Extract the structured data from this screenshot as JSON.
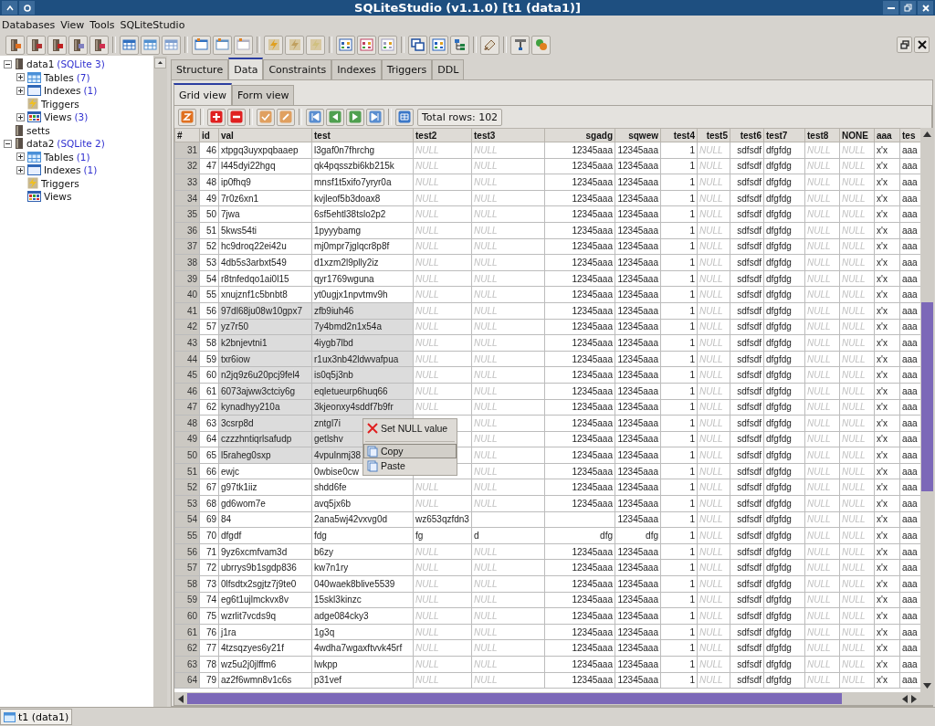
{
  "window": {
    "title": "SQLiteStudio (v1.1.0) [t1 (data1)]"
  },
  "menu": [
    "Databases",
    "View",
    "Tools",
    "SQLiteStudio"
  ],
  "tree": [
    {
      "label": "data1",
      "note": "(SQLite 3)",
      "kind": "database",
      "expanded": true,
      "children": [
        {
          "label": "Tables",
          "note": "(7)",
          "kind": "tables",
          "expanded": false
        },
        {
          "label": "Indexes",
          "note": "(1)",
          "kind": "indexes",
          "expanded": false
        },
        {
          "label": "Triggers",
          "kind": "triggers"
        },
        {
          "label": "Views",
          "note": "(3)",
          "kind": "views",
          "expanded": false
        }
      ]
    },
    {
      "label": "setts",
      "kind": "database"
    },
    {
      "label": "data2",
      "note": "(SQLite 2)",
      "kind": "database",
      "expanded": true,
      "children": [
        {
          "label": "Tables",
          "note": "(1)",
          "kind": "tables",
          "expanded": false
        },
        {
          "label": "Indexes",
          "note": "(1)",
          "kind": "indexes",
          "expanded": false
        },
        {
          "label": "Triggers",
          "kind": "triggers"
        },
        {
          "label": "Views",
          "kind": "views"
        }
      ]
    }
  ],
  "tabs": [
    {
      "label": "Structure",
      "selected": false
    },
    {
      "label": "Data",
      "selected": true
    },
    {
      "label": "Constraints",
      "selected": false
    },
    {
      "label": "Indexes",
      "selected": false
    },
    {
      "label": "Triggers",
      "selected": false
    },
    {
      "label": "DDL",
      "selected": false
    }
  ],
  "subtabs": [
    {
      "label": "Grid view",
      "selected": true
    },
    {
      "label": "Form view",
      "selected": false
    }
  ],
  "total_rows": "Total rows: 102",
  "table": {
    "columns": [
      "#",
      "id",
      "val",
      "test",
      "test2",
      "test3",
      "sgadg",
      "sqwew",
      "test4",
      "test5",
      "test6",
      "test7",
      "test8",
      "NONE",
      "aaa",
      "tes"
    ],
    "rows": [
      {
        "selected": false,
        "cells": [
          "31",
          "46",
          "xtpgq3uyxpqbaaep",
          "l3gaf0n7fhrchg",
          {
            "text": "NULL",
            "null": true
          },
          {
            "text": "NULL",
            "null": true
          },
          "12345aaa",
          "12345aaa",
          "1",
          {
            "text": "NULL",
            "null": true
          },
          "sdfsdf",
          "dfgfdg",
          {
            "text": "NULL",
            "null": true
          },
          {
            "text": "NULL",
            "null": true
          },
          "x'x",
          "aaa"
        ]
      },
      {
        "selected": false,
        "cells": [
          "32",
          "47",
          "l445dyi22hgq",
          "qk4pqsszbi6kb215k",
          {
            "text": "NULL",
            "null": true
          },
          {
            "text": "NULL",
            "null": true
          },
          "12345aaa",
          "12345aaa",
          "1",
          {
            "text": "NULL",
            "null": true
          },
          "sdfsdf",
          "dfgfdg",
          {
            "text": "NULL",
            "null": true
          },
          {
            "text": "NULL",
            "null": true
          },
          "x'x",
          "aaa"
        ]
      },
      {
        "selected": false,
        "cells": [
          "33",
          "48",
          "ip0fhq9",
          "mnsf1t5xifo7yryr0a",
          {
            "text": "NULL",
            "null": true
          },
          {
            "text": "NULL",
            "null": true
          },
          "12345aaa",
          "12345aaa",
          "1",
          {
            "text": "NULL",
            "null": true
          },
          "sdfsdf",
          "dfgfdg",
          {
            "text": "NULL",
            "null": true
          },
          {
            "text": "NULL",
            "null": true
          },
          "x'x",
          "aaa"
        ]
      },
      {
        "selected": false,
        "cells": [
          "34",
          "49",
          "7r0z6xn1",
          "kvjleof5b3doax8",
          {
            "text": "NULL",
            "null": true
          },
          {
            "text": "NULL",
            "null": true
          },
          "12345aaa",
          "12345aaa",
          "1",
          {
            "text": "NULL",
            "null": true
          },
          "sdfsdf",
          "dfgfdg",
          {
            "text": "NULL",
            "null": true
          },
          {
            "text": "NULL",
            "null": true
          },
          "x'x",
          "aaa"
        ]
      },
      {
        "selected": false,
        "cells": [
          "35",
          "50",
          "7jwa",
          "6sf5ehtl38tslo2p2",
          {
            "text": "NULL",
            "null": true
          },
          {
            "text": "NULL",
            "null": true
          },
          "12345aaa",
          "12345aaa",
          "1",
          {
            "text": "NULL",
            "null": true
          },
          "sdfsdf",
          "dfgfdg",
          {
            "text": "NULL",
            "null": true
          },
          {
            "text": "NULL",
            "null": true
          },
          "x'x",
          "aaa"
        ]
      },
      {
        "selected": false,
        "cells": [
          "36",
          "51",
          "5kws54ti",
          "1pyyybamg",
          {
            "text": "NULL",
            "null": true
          },
          {
            "text": "NULL",
            "null": true
          },
          "12345aaa",
          "12345aaa",
          "1",
          {
            "text": "NULL",
            "null": true
          },
          "sdfsdf",
          "dfgfdg",
          {
            "text": "NULL",
            "null": true
          },
          {
            "text": "NULL",
            "null": true
          },
          "x'x",
          "aaa"
        ]
      },
      {
        "selected": false,
        "cells": [
          "37",
          "52",
          "hc9droq22ei42u",
          "mj0mpr7jglqcr8p8f",
          {
            "text": "NULL",
            "null": true
          },
          {
            "text": "NULL",
            "null": true
          },
          "12345aaa",
          "12345aaa",
          "1",
          {
            "text": "NULL",
            "null": true
          },
          "sdfsdf",
          "dfgfdg",
          {
            "text": "NULL",
            "null": true
          },
          {
            "text": "NULL",
            "null": true
          },
          "x'x",
          "aaa"
        ]
      },
      {
        "selected": false,
        "cells": [
          "38",
          "53",
          "4db5s3arbxt549",
          "d1xzm2l9plly2iz",
          {
            "text": "NULL",
            "null": true
          },
          {
            "text": "NULL",
            "null": true
          },
          "12345aaa",
          "12345aaa",
          "1",
          {
            "text": "NULL",
            "null": true
          },
          "sdfsdf",
          "dfgfdg",
          {
            "text": "NULL",
            "null": true
          },
          {
            "text": "NULL",
            "null": true
          },
          "x'x",
          "aaa"
        ]
      },
      {
        "selected": false,
        "cells": [
          "39",
          "54",
          "r8tnfedqo1ai0l15",
          "qyr1769wguna",
          {
            "text": "NULL",
            "null": true
          },
          {
            "text": "NULL",
            "null": true
          },
          "12345aaa",
          "12345aaa",
          "1",
          {
            "text": "NULL",
            "null": true
          },
          "sdfsdf",
          "dfgfdg",
          {
            "text": "NULL",
            "null": true
          },
          {
            "text": "NULL",
            "null": true
          },
          "x'x",
          "aaa"
        ]
      },
      {
        "selected": false,
        "cells": [
          "40",
          "55",
          "xnujznf1c5bnbt8",
          "yt0ugjx1npvtmv9h",
          {
            "text": "NULL",
            "null": true
          },
          {
            "text": "NULL",
            "null": true
          },
          "12345aaa",
          "12345aaa",
          "1",
          {
            "text": "NULL",
            "null": true
          },
          "sdfsdf",
          "dfgfdg",
          {
            "text": "NULL",
            "null": true
          },
          {
            "text": "NULL",
            "null": true
          },
          "x'x",
          "aaa"
        ]
      },
      {
        "selected": true,
        "cells": [
          "41",
          "56",
          "97dl68ju08w10gpx7",
          "zfb9iuh46",
          {
            "text": "NULL",
            "null": true
          },
          {
            "text": "NULL",
            "null": true
          },
          "12345aaa",
          "12345aaa",
          "1",
          {
            "text": "NULL",
            "null": true
          },
          "sdfsdf",
          "dfgfdg",
          {
            "text": "NULL",
            "null": true
          },
          {
            "text": "NULL",
            "null": true
          },
          "x'x",
          "aaa"
        ]
      },
      {
        "selected": true,
        "cells": [
          "42",
          "57",
          "yz7r50",
          "7y4bmd2n1x54a",
          {
            "text": "NULL",
            "null": true
          },
          {
            "text": "NULL",
            "null": true
          },
          "12345aaa",
          "12345aaa",
          "1",
          {
            "text": "NULL",
            "null": true
          },
          "sdfsdf",
          "dfgfdg",
          {
            "text": "NULL",
            "null": true
          },
          {
            "text": "NULL",
            "null": true
          },
          "x'x",
          "aaa"
        ]
      },
      {
        "selected": true,
        "cells": [
          "43",
          "58",
          "k2bnjevtni1",
          "4iygb7lbd",
          {
            "text": "NULL",
            "null": true
          },
          {
            "text": "NULL",
            "null": true
          },
          "12345aaa",
          "12345aaa",
          "1",
          {
            "text": "NULL",
            "null": true
          },
          "sdfsdf",
          "dfgfdg",
          {
            "text": "NULL",
            "null": true
          },
          {
            "text": "NULL",
            "null": true
          },
          "x'x",
          "aaa"
        ]
      },
      {
        "selected": true,
        "cells": [
          "44",
          "59",
          "txr6iow",
          "r1ux3nb42ldwvafpua",
          {
            "text": "NULL",
            "null": true
          },
          {
            "text": "NULL",
            "null": true
          },
          "12345aaa",
          "12345aaa",
          "1",
          {
            "text": "NULL",
            "null": true
          },
          "sdfsdf",
          "dfgfdg",
          {
            "text": "NULL",
            "null": true
          },
          {
            "text": "NULL",
            "null": true
          },
          "x'x",
          "aaa"
        ]
      },
      {
        "selected": true,
        "cells": [
          "45",
          "60",
          "n2jq9z6u20pcj9fel4",
          "is0q5j3nb",
          {
            "text": "NULL",
            "null": true
          },
          {
            "text": "NULL",
            "null": true
          },
          "12345aaa",
          "12345aaa",
          "1",
          {
            "text": "NULL",
            "null": true
          },
          "sdfsdf",
          "dfgfdg",
          {
            "text": "NULL",
            "null": true
          },
          {
            "text": "NULL",
            "null": true
          },
          "x'x",
          "aaa"
        ]
      },
      {
        "selected": true,
        "cells": [
          "46",
          "61",
          "6073ajww3ctciy6g",
          "eqletueurp6huq66",
          {
            "text": "NULL",
            "null": true
          },
          {
            "text": "NULL",
            "null": true
          },
          "12345aaa",
          "12345aaa",
          "1",
          {
            "text": "NULL",
            "null": true
          },
          "sdfsdf",
          "dfgfdg",
          {
            "text": "NULL",
            "null": true
          },
          {
            "text": "NULL",
            "null": true
          },
          "x'x",
          "aaa"
        ]
      },
      {
        "selected": true,
        "cells": [
          "47",
          "62",
          "kynadhyy210a",
          "3kjeonxy4sddf7b9fr",
          {
            "text": "NULL",
            "null": true
          },
          {
            "text": "NULL",
            "null": true
          },
          "12345aaa",
          "12345aaa",
          "1",
          {
            "text": "NULL",
            "null": true
          },
          "sdfsdf",
          "dfgfdg",
          {
            "text": "NULL",
            "null": true
          },
          {
            "text": "NULL",
            "null": true
          },
          "x'x",
          "aaa"
        ]
      },
      {
        "selected": true,
        "cells": [
          "48",
          "63",
          "3csrp8d",
          "zntgl7i",
          null,
          {
            "text": "NULL",
            "null": true
          },
          "12345aaa",
          "12345aaa",
          "1",
          {
            "text": "NULL",
            "null": true
          },
          "sdfsdf",
          "dfgfdg",
          {
            "text": "NULL",
            "null": true
          },
          {
            "text": "NULL",
            "null": true
          },
          "x'x",
          "aaa"
        ]
      },
      {
        "selected": true,
        "cells": [
          "49",
          "64",
          "czzzhntiqrlsafudp",
          "getlshv",
          null,
          {
            "text": "NULL",
            "null": true
          },
          "12345aaa",
          "12345aaa",
          "1",
          {
            "text": "NULL",
            "null": true
          },
          "sdfsdf",
          "dfgfdg",
          {
            "text": "NULL",
            "null": true
          },
          {
            "text": "NULL",
            "null": true
          },
          "x'x",
          "aaa"
        ]
      },
      {
        "selected": true,
        "cells": [
          "50",
          "65",
          "l5raheg0sxp",
          "4vpulnmj38",
          null,
          {
            "text": "NULL",
            "null": true
          },
          "12345aaa",
          "12345aaa",
          "1",
          {
            "text": "NULL",
            "null": true
          },
          "sdfsdf",
          "dfgfdg",
          {
            "text": "NULL",
            "null": true
          },
          {
            "text": "NULL",
            "null": true
          },
          "x'x",
          "aaa"
        ]
      },
      {
        "selected": false,
        "cells": [
          "51",
          "66",
          "ewjc",
          "0wbise0cw",
          null,
          {
            "text": "NULL",
            "null": true
          },
          "12345aaa",
          "12345aaa",
          "1",
          {
            "text": "NULL",
            "null": true
          },
          "sdfsdf",
          "dfgfdg",
          {
            "text": "NULL",
            "null": true
          },
          {
            "text": "NULL",
            "null": true
          },
          "x'x",
          "aaa"
        ]
      },
      {
        "selected": false,
        "cells": [
          "52",
          "67",
          "g97tk1iiz",
          "shdd6fe",
          {
            "text": "NULL",
            "null": true
          },
          {
            "text": "NULL",
            "null": true
          },
          "12345aaa",
          "12345aaa",
          "1",
          {
            "text": "NULL",
            "null": true
          },
          "sdfsdf",
          "dfgfdg",
          {
            "text": "NULL",
            "null": true
          },
          {
            "text": "NULL",
            "null": true
          },
          "x'x",
          "aaa"
        ]
      },
      {
        "selected": false,
        "cells": [
          "53",
          "68",
          "gd6wom7e",
          "avq5jx6b",
          {
            "text": "NULL",
            "null": true
          },
          {
            "text": "NULL",
            "null": true
          },
          "12345aaa",
          "12345aaa",
          "1",
          {
            "text": "NULL",
            "null": true
          },
          "sdfsdf",
          "dfgfdg",
          {
            "text": "NULL",
            "null": true
          },
          {
            "text": "NULL",
            "null": true
          },
          "x'x",
          "aaa"
        ]
      },
      {
        "selected": false,
        "cells": [
          "54",
          "69",
          "84",
          "2ana5wj42vxvg0d",
          "wz653qzfdn3",
          null,
          null,
          "12345aaa",
          "1",
          {
            "text": "NULL",
            "null": true
          },
          "sdfsdf",
          "dfgfdg",
          {
            "text": "NULL",
            "null": true
          },
          {
            "text": "NULL",
            "null": true
          },
          "x'x",
          "aaa"
        ]
      },
      {
        "selected": false,
        "cells": [
          "55",
          "70",
          "dfgdf",
          "fdg",
          "fg",
          "d",
          "dfg",
          "dfg",
          "1",
          {
            "text": "NULL",
            "null": true
          },
          "sdfsdf",
          "dfgfdg",
          {
            "text": "NULL",
            "null": true
          },
          {
            "text": "NULL",
            "null": true
          },
          "x'x",
          "aaa"
        ]
      },
      {
        "selected": false,
        "cells": [
          "56",
          "71",
          "9yz6xcmfvam3d",
          "b6zy",
          {
            "text": "NULL",
            "null": true
          },
          {
            "text": "NULL",
            "null": true
          },
          "12345aaa",
          "12345aaa",
          "1",
          {
            "text": "NULL",
            "null": true
          },
          "sdfsdf",
          "dfgfdg",
          {
            "text": "NULL",
            "null": true
          },
          {
            "text": "NULL",
            "null": true
          },
          "x'x",
          "aaa"
        ]
      },
      {
        "selected": false,
        "cells": [
          "57",
          "72",
          "ubrrys9b1sgdp836",
          "kw7n1ry",
          {
            "text": "NULL",
            "null": true
          },
          {
            "text": "NULL",
            "null": true
          },
          "12345aaa",
          "12345aaa",
          "1",
          {
            "text": "NULL",
            "null": true
          },
          "sdfsdf",
          "dfgfdg",
          {
            "text": "NULL",
            "null": true
          },
          {
            "text": "NULL",
            "null": true
          },
          "x'x",
          "aaa"
        ]
      },
      {
        "selected": false,
        "cells": [
          "58",
          "73",
          "0lfsdtx2sgjtz7j9te0",
          "040waek8blive5539",
          {
            "text": "NULL",
            "null": true
          },
          {
            "text": "NULL",
            "null": true
          },
          "12345aaa",
          "12345aaa",
          "1",
          {
            "text": "NULL",
            "null": true
          },
          "sdfsdf",
          "dfgfdg",
          {
            "text": "NULL",
            "null": true
          },
          {
            "text": "NULL",
            "null": true
          },
          "x'x",
          "aaa"
        ]
      },
      {
        "selected": false,
        "cells": [
          "59",
          "74",
          "eg6t1ujlmckvx8v",
          "15skl3kinzc",
          {
            "text": "NULL",
            "null": true
          },
          {
            "text": "NULL",
            "null": true
          },
          "12345aaa",
          "12345aaa",
          "1",
          {
            "text": "NULL",
            "null": true
          },
          "sdfsdf",
          "dfgfdg",
          {
            "text": "NULL",
            "null": true
          },
          {
            "text": "NULL",
            "null": true
          },
          "x'x",
          "aaa"
        ]
      },
      {
        "selected": false,
        "cells": [
          "60",
          "75",
          "wzrlit7vcds9q",
          "adge084cky3",
          {
            "text": "NULL",
            "null": true
          },
          {
            "text": "NULL",
            "null": true
          },
          "12345aaa",
          "12345aaa",
          "1",
          {
            "text": "NULL",
            "null": true
          },
          "sdfsdf",
          "dfgfdg",
          {
            "text": "NULL",
            "null": true
          },
          {
            "text": "NULL",
            "null": true
          },
          "x'x",
          "aaa"
        ]
      },
      {
        "selected": false,
        "cells": [
          "61",
          "76",
          "j1ra",
          "1g3q",
          {
            "text": "NULL",
            "null": true
          },
          {
            "text": "NULL",
            "null": true
          },
          "12345aaa",
          "12345aaa",
          "1",
          {
            "text": "NULL",
            "null": true
          },
          "sdfsdf",
          "dfgfdg",
          {
            "text": "NULL",
            "null": true
          },
          {
            "text": "NULL",
            "null": true
          },
          "x'x",
          "aaa"
        ]
      },
      {
        "selected": false,
        "cells": [
          "62",
          "77",
          "4tzsqzyes6y21f",
          "4wdha7wgaxftvvk45rf",
          {
            "text": "NULL",
            "null": true
          },
          {
            "text": "NULL",
            "null": true
          },
          "12345aaa",
          "12345aaa",
          "1",
          {
            "text": "NULL",
            "null": true
          },
          "sdfsdf",
          "dfgfdg",
          {
            "text": "NULL",
            "null": true
          },
          {
            "text": "NULL",
            "null": true
          },
          "x'x",
          "aaa"
        ]
      },
      {
        "selected": false,
        "cells": [
          "63",
          "78",
          "wz5u2j0jlffm6",
          "lwkpp",
          {
            "text": "NULL",
            "null": true
          },
          {
            "text": "NULL",
            "null": true
          },
          "12345aaa",
          "12345aaa",
          "1",
          {
            "text": "NULL",
            "null": true
          },
          "sdfsdf",
          "dfgfdg",
          {
            "text": "NULL",
            "null": true
          },
          {
            "text": "NULL",
            "null": true
          },
          "x'x",
          "aaa"
        ]
      },
      {
        "selected": false,
        "cells": [
          "64",
          "79",
          "az2f6wmn8v1c6s",
          "p31vef",
          {
            "text": "NULL",
            "null": true
          },
          {
            "text": "NULL",
            "null": true
          },
          "12345aaa",
          "12345aaa",
          "1",
          {
            "text": "NULL",
            "null": true
          },
          "sdfsdf",
          "dfgfdg",
          {
            "text": "NULL",
            "null": true
          },
          {
            "text": "NULL",
            "null": true
          },
          "x'x",
          "aaa"
        ]
      }
    ]
  },
  "context_menu": {
    "items": [
      {
        "kind": "delete",
        "label": "Set NULL value",
        "selected": false
      },
      {
        "kind": "separator"
      },
      {
        "kind": "copy",
        "label": "Copy",
        "selected": true
      },
      {
        "kind": "paste",
        "label": "Paste",
        "selected": false
      }
    ]
  },
  "taskbar": {
    "items": [
      {
        "label": "t1 (data1)",
        "selected": true
      }
    ]
  }
}
